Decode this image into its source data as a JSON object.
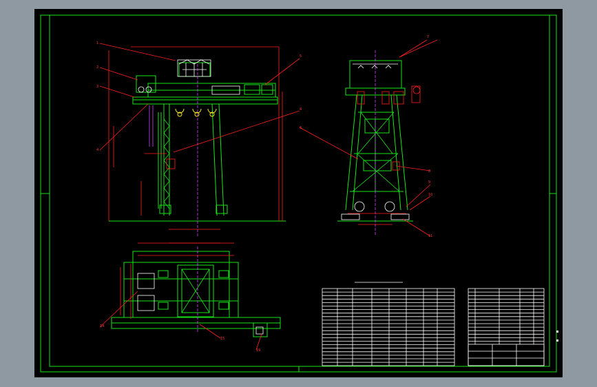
{
  "part_labels": [
    "1",
    "2",
    "3",
    "4",
    "4",
    "5",
    "6",
    "7",
    "8",
    "9",
    "10",
    "11",
    "12",
    "14",
    "15",
    "19"
  ],
  "colors": {
    "background": "#8e99a2",
    "drawing_background": "#000000",
    "frame": "#19e619",
    "leader": "#ff2020",
    "text": "#ffffff",
    "hook": "#f5e614"
  }
}
